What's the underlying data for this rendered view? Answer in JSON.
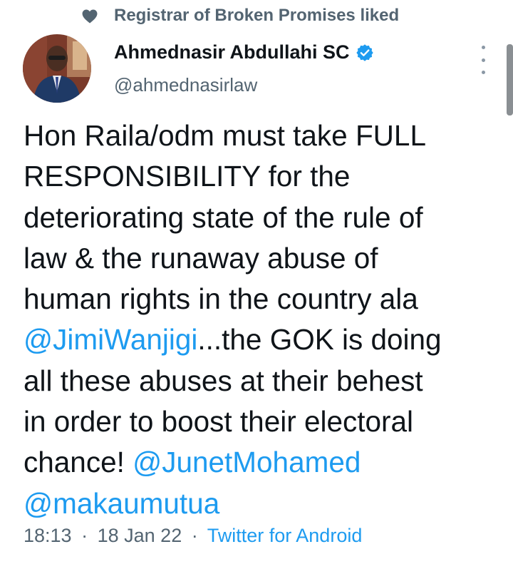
{
  "social_context": {
    "text": "Registrar of Broken Promises liked",
    "icon": "heart-icon"
  },
  "author": {
    "display_name": "Ahmednasir Abdullahi SC",
    "handle": "@ahmednasirlaw",
    "verified_icon": "verified-badge-icon"
  },
  "tweet": {
    "lines": [
      [
        {
          "text": "Hon Raila/odm must take FULL"
        }
      ],
      [
        {
          "text": "RESPONSIBILITY for the"
        }
      ],
      [
        {
          "text": "deteriorating state of the rule of"
        }
      ],
      [
        {
          "text": "law & the runaway abuse of"
        }
      ],
      [
        {
          "text": "human rights in the country ala"
        }
      ],
      [
        {
          "text": "@JimiWanjigi",
          "mention": true
        },
        {
          "text": "...the GOK is doing"
        }
      ],
      [
        {
          "text": "all these abuses at their behest"
        }
      ],
      [
        {
          "text": "in order to boost their electoral"
        }
      ],
      [
        {
          "text": "chance! "
        },
        {
          "text": "@JunetMohamed",
          "mention": true
        }
      ],
      [
        {
          "text": "@makaumutua",
          "mention": true
        }
      ]
    ]
  },
  "meta": {
    "time": "18:13",
    "separator": "·",
    "date": "18 Jan 22",
    "source": "Twitter for Android"
  },
  "colors": {
    "link": "#1d9bf0",
    "secondary_text": "#536471",
    "primary_text": "#0f1419"
  }
}
